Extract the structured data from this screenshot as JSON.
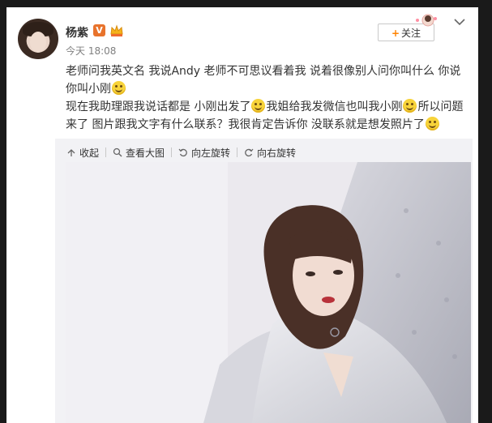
{
  "user": {
    "name": "杨紫",
    "verified_badge": "V",
    "timestamp": "今天 18:08",
    "avatar_icon": "avatar"
  },
  "actions": {
    "follow_label": "关注",
    "follow_plus": "+"
  },
  "post": {
    "paragraphs": [
      [
        "老师问我英文名 我说Andy 老师不可思议看着我 说着很像别人问你叫什么 你说你叫小刚",
        "smile"
      ],
      [
        "现在我助理跟我说话都是 小刚出发了",
        "smile",
        "我姐给我发微信也叫我小刚",
        "smile",
        "所以问题来了 图片跟我文字有什么联系？我很肯定告诉你 没联系就是想发照片了",
        "smile"
      ]
    ]
  },
  "media_toolbar": {
    "collapse": "收起",
    "view_large": "查看大图",
    "rotate_left": "向左旋转",
    "rotate_right": "向右旋转"
  },
  "colors": {
    "accent": "#ff8200",
    "text": "#333333",
    "muted": "#808080",
    "badge": "#e8732c"
  }
}
